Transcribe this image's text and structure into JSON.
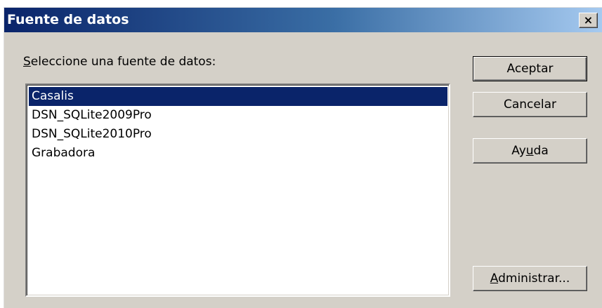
{
  "window": {
    "title": "Fuente de datos",
    "close_glyph": "×"
  },
  "prompt": {
    "mnemonic": "S",
    "rest": "eleccione una fuente de datos:"
  },
  "data_sources": [
    {
      "label": "Casalis",
      "selected": true
    },
    {
      "label": "DSN_SQLite2009Pro",
      "selected": false
    },
    {
      "label": "DSN_SQLite2010Pro",
      "selected": false
    },
    {
      "label": "Grabadora",
      "selected": false
    }
  ],
  "buttons": {
    "accept": "Aceptar",
    "cancel": "Cancelar",
    "help": {
      "before": "Ay",
      "mnemonic": "u",
      "after": "da"
    },
    "manage": {
      "mnemonic": "A",
      "after": "dministrar..."
    }
  },
  "colors": {
    "title_bar_start": "#0a246a",
    "title_bar_end": "#a6caf0",
    "selection": "#0a246a",
    "dialog_face": "#d4d0c8"
  }
}
